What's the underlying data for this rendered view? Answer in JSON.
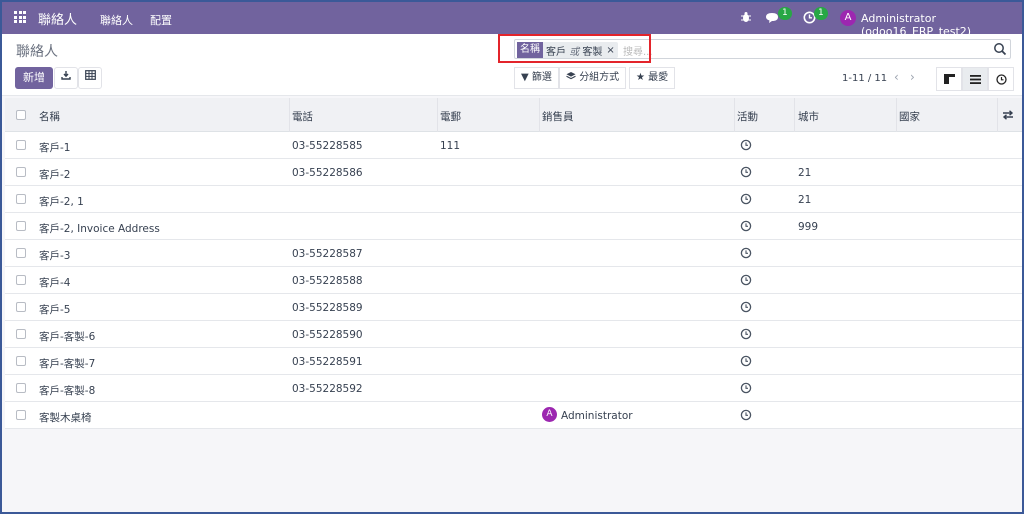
{
  "navbar": {
    "brand": "聯絡人",
    "menu": [
      "聯絡人",
      "配置"
    ],
    "messages_count": "1",
    "activities_count": "1",
    "user_initial": "A",
    "user_name": "Administrator (odoo16_ERP_test2)",
    "accent": "#71639e"
  },
  "control": {
    "title": "聯絡人",
    "new_label": "新增",
    "search": {
      "facet_label": "名稱",
      "facet_value_1": "客戶",
      "facet_or": "或",
      "facet_value_2": "客製",
      "remove": "×",
      "placeholder": "搜尋..."
    },
    "filters_label": "篩選",
    "groupby_label": "分組方式",
    "favorites_label": "最愛",
    "pager": "1-11 / 11"
  },
  "table": {
    "columns": [
      "名稱",
      "電話",
      "電郵",
      "銷售員",
      "活動",
      "城市",
      "國家"
    ],
    "rows": [
      {
        "name": "客戶-1",
        "phone": "03-55228585",
        "email": "111",
        "salesperson": "",
        "city": ""
      },
      {
        "name": "客戶-2",
        "phone": "03-55228586",
        "email": "",
        "salesperson": "",
        "city": "21"
      },
      {
        "name": "客戶-2, 1",
        "phone": "",
        "email": "",
        "salesperson": "",
        "city": "21"
      },
      {
        "name": "客戶-2, Invoice Address",
        "phone": "",
        "email": "",
        "salesperson": "",
        "city": "999"
      },
      {
        "name": "客戶-3",
        "phone": "03-55228587",
        "email": "",
        "salesperson": "",
        "city": ""
      },
      {
        "name": "客戶-4",
        "phone": "03-55228588",
        "email": "",
        "salesperson": "",
        "city": ""
      },
      {
        "name": "客戶-5",
        "phone": "03-55228589",
        "email": "",
        "salesperson": "",
        "city": ""
      },
      {
        "name": "客戶-客製-6",
        "phone": "03-55228590",
        "email": "",
        "salesperson": "",
        "city": ""
      },
      {
        "name": "客戶-客製-7",
        "phone": "03-55228591",
        "email": "",
        "salesperson": "",
        "city": ""
      },
      {
        "name": "客戶-客製-8",
        "phone": "03-55228592",
        "email": "",
        "salesperson": "",
        "city": ""
      },
      {
        "name": "客製木桌椅",
        "phone": "",
        "email": "",
        "salesperson": "Administrator",
        "city": ""
      }
    ]
  }
}
